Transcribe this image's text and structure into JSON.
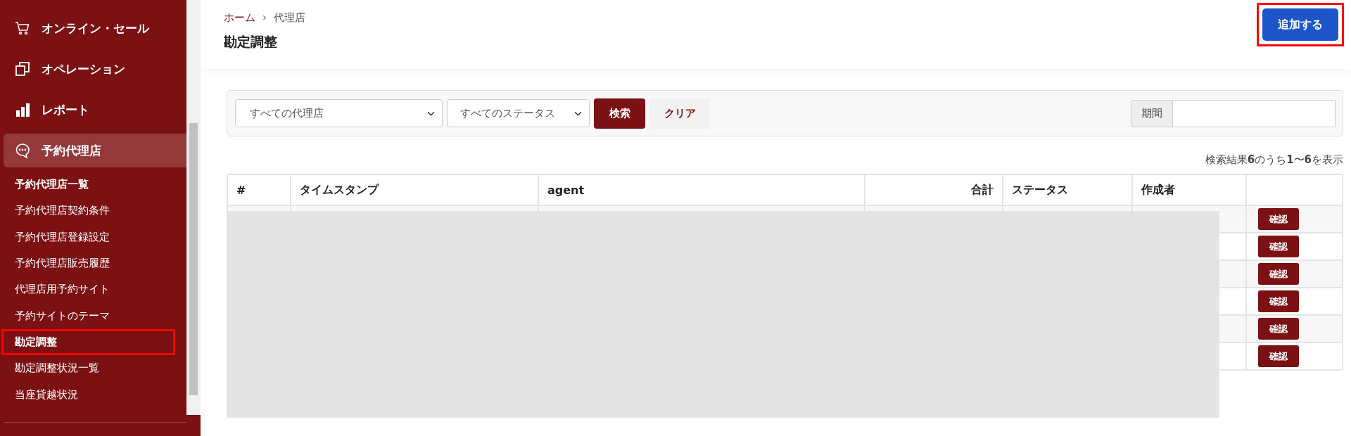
{
  "sidebar": {
    "menu": [
      {
        "label": "オンライン・セール",
        "selected": false
      },
      {
        "label": "オペレーション",
        "selected": false
      },
      {
        "label": "レポート",
        "selected": false
      },
      {
        "label": "予約代理店",
        "selected": true
      }
    ],
    "submenu": [
      {
        "label": "予約代理店一覧",
        "bold": true,
        "highlighted": false
      },
      {
        "label": "予約代理店契約条件",
        "bold": false,
        "highlighted": false
      },
      {
        "label": "予約代理店登録設定",
        "bold": false,
        "highlighted": false
      },
      {
        "label": "予約代理店販売履歴",
        "bold": false,
        "highlighted": false
      },
      {
        "label": "代理店用予約サイト",
        "bold": false,
        "highlighted": false
      },
      {
        "label": "予約サイトのテーマ",
        "bold": false,
        "highlighted": false
      },
      {
        "label": "勘定調整",
        "bold": true,
        "highlighted": true
      },
      {
        "label": "勘定調整状況一覧",
        "bold": false,
        "highlighted": false
      },
      {
        "label": "当座貸越状況",
        "bold": false,
        "highlighted": false
      }
    ]
  },
  "breadcrumb": {
    "items": [
      "ホーム",
      "代理店"
    ],
    "separator": "›"
  },
  "page_title": "勘定調整",
  "add_button": {
    "label": "追加する",
    "highlighted": true
  },
  "filters": {
    "agent_select": "すべての代理店",
    "status_select": "すべてのステータス",
    "search_button": "検索",
    "clear_button": "クリア",
    "period_label": "期間"
  },
  "result_count": "検索結果**6**のうち**1**〜**6**を表示",
  "table": {
    "columns": [
      "#",
      "タイムスタンプ",
      "agent",
      "合計",
      "ステータス",
      "作成者"
    ],
    "rows": [
      {
        "action": "確認"
      },
      {
        "action": "確認"
      },
      {
        "action": "確認"
      },
      {
        "action": "確認"
      },
      {
        "action": "確認"
      },
      {
        "action": "確認"
      }
    ],
    "redacted": true
  }
}
